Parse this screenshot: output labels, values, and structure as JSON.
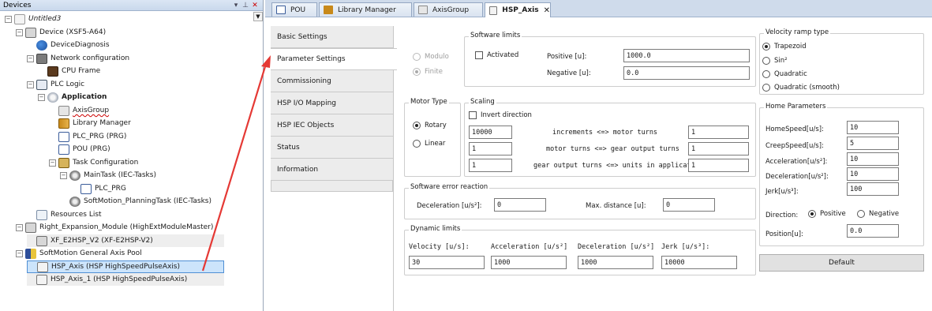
{
  "devices_panel": {
    "title": "Devices",
    "pin_label": "▾ ⌖",
    "close_label": "✕",
    "tree": [
      {
        "label": "Untitled3",
        "depth": 0,
        "expander": "−",
        "icon": "doc",
        "style": "italic"
      },
      {
        "label": "Device (XSF5-A64)",
        "depth": 1,
        "expander": "−",
        "icon": "dev"
      },
      {
        "label": "DeviceDiagnosis",
        "depth": 2,
        "expander": "",
        "icon": "diag"
      },
      {
        "label": "Network configuration",
        "depth": 2,
        "expander": "−",
        "icon": "net"
      },
      {
        "label": "CPU Frame",
        "depth": 3,
        "expander": "",
        "icon": "cpu"
      },
      {
        "label": "PLC Logic",
        "depth": 2,
        "expander": "−",
        "icon": "plc"
      },
      {
        "label": "Application",
        "depth": 3,
        "expander": "−",
        "icon": "app",
        "style": "bold"
      },
      {
        "label": "AxisGroup",
        "depth": 4,
        "expander": "",
        "icon": "axisgroup",
        "style": "squig"
      },
      {
        "label": "Library Manager",
        "depth": 4,
        "expander": "",
        "icon": "lib"
      },
      {
        "label": "PLC_PRG (PRG)",
        "depth": 4,
        "expander": "",
        "icon": "prg"
      },
      {
        "label": "POU (PRG)",
        "depth": 4,
        "expander": "",
        "icon": "prg"
      },
      {
        "label": "Task Configuration",
        "depth": 4,
        "expander": "−",
        "icon": "task"
      },
      {
        "label": "MainTask (IEC-Tasks)",
        "depth": 5,
        "expander": "−",
        "icon": "gear"
      },
      {
        "label": "PLC_PRG",
        "depth": 6,
        "expander": "",
        "icon": "prg"
      },
      {
        "label": "SoftMotion_PlanningTask (IEC-Tasks)",
        "depth": 5,
        "expander": "",
        "icon": "gear"
      },
      {
        "label": "Resources List",
        "depth": 2,
        "expander": "",
        "icon": "res"
      },
      {
        "label": "Right_Expansion_Module (HighExtModuleMaster)",
        "depth": 1,
        "expander": "−",
        "icon": "dev"
      },
      {
        "label": "XF_E2HSP_V2 (XF-E2HSP-V2)",
        "depth": 2,
        "expander": "",
        "icon": "dev",
        "style": "gray"
      },
      {
        "label": "SoftMotion General Axis Pool",
        "depth": 1,
        "expander": "−",
        "icon": "pool"
      },
      {
        "label": "HSP_Axis (HSP HighSpeedPulseAxis)",
        "depth": 2,
        "expander": "",
        "icon": "axis",
        "style": "sel"
      },
      {
        "label": "HSP_Axis_1 (HSP HighSpeedPulseAxis)",
        "depth": 2,
        "expander": "",
        "icon": "axis",
        "style": "gray"
      }
    ]
  },
  "tabs": [
    {
      "label": "POU",
      "icon_color": "#3a5c9a"
    },
    {
      "label": "Library Manager",
      "icon_color": "#c8891a"
    },
    {
      "label": "AxisGroup",
      "icon_color": "#8a8a8a"
    },
    {
      "label": "HSP_Axis",
      "icon_color": "#767676",
      "active": true,
      "close": "✕"
    }
  ],
  "side_nav": [
    "Basic Settings",
    "Parameter Settings",
    "Commissioning",
    "HSP I/O Mapping",
    "HSP IEC Objects",
    "Status",
    "Information"
  ],
  "side_nav_active": 1,
  "axis_type": {
    "modulo": "Modulo",
    "finite": "Finite",
    "selected": "Finite"
  },
  "software_limits": {
    "title": "Software limits",
    "activated_label": "Activated",
    "activated": false,
    "positive_label": "Positive [u]:",
    "positive_value": "1000.0",
    "negative_label": "Negative [u]:",
    "negative_value": "0.0"
  },
  "motor_type": {
    "title": "Motor Type",
    "rotary": "Rotary",
    "linear": "Linear",
    "selected": "Rotary"
  },
  "scaling": {
    "title": "Scaling",
    "invert_label": "Invert direction",
    "invert": false,
    "rows": [
      {
        "left": "10000",
        "label": "increments <=> motor turns",
        "right": "1"
      },
      {
        "left": "1",
        "label": "motor turns <=> gear output turns",
        "right": "1"
      },
      {
        "left": "1",
        "label": "gear output turns <=> units in application",
        "right": "1"
      }
    ]
  },
  "software_error": {
    "title": "Software error reaction",
    "decel_label": "Deceleration [u/s²]:",
    "decel_value": "0",
    "maxdist_label": "Max. distance [u]:",
    "maxdist_value": "0"
  },
  "dynamic_limits": {
    "title": "Dynamic limits",
    "velocity_label": "Velocity [u/s]:",
    "velocity_value": "30",
    "acceleration_label": "Acceleration [u/s²]",
    "acceleration_value": "1000",
    "deceleration_label": "Deceleration [u/s²]",
    "deceleration_value": "1000",
    "jerk_label": "Jerk [u/s³]:",
    "jerk_value": "10000"
  },
  "velocity_ramp": {
    "title": "Velocity ramp type",
    "options": [
      "Trapezoid",
      "Sin²",
      "Quadratic",
      "Quadratic (smooth)"
    ],
    "selected": 0
  },
  "home_params": {
    "title": "Home Parameters",
    "homespeed_label": "HomeSpeed[u/s]:",
    "homespeed_value": "10",
    "creepspeed_label": "CreepSpeed[u/s]:",
    "creepspeed_value": "5",
    "acceleration_label": "Acceleration[u/s²]:",
    "acceleration_value": "10",
    "deceleration_label": "Deceleration[u/s²]:",
    "deceleration_value": "10",
    "jerk_label": "Jerk[u/s³]:",
    "jerk_value": "100",
    "direction_label": "Direction:",
    "positive": "Positive",
    "negative": "Negative",
    "direction_selected": "Positive",
    "position_label": "Position[u]:",
    "position_value": "0.0"
  },
  "default_button": "Default",
  "colors": {
    "arrow": "#e53935",
    "selection": "#cce4fb"
  }
}
